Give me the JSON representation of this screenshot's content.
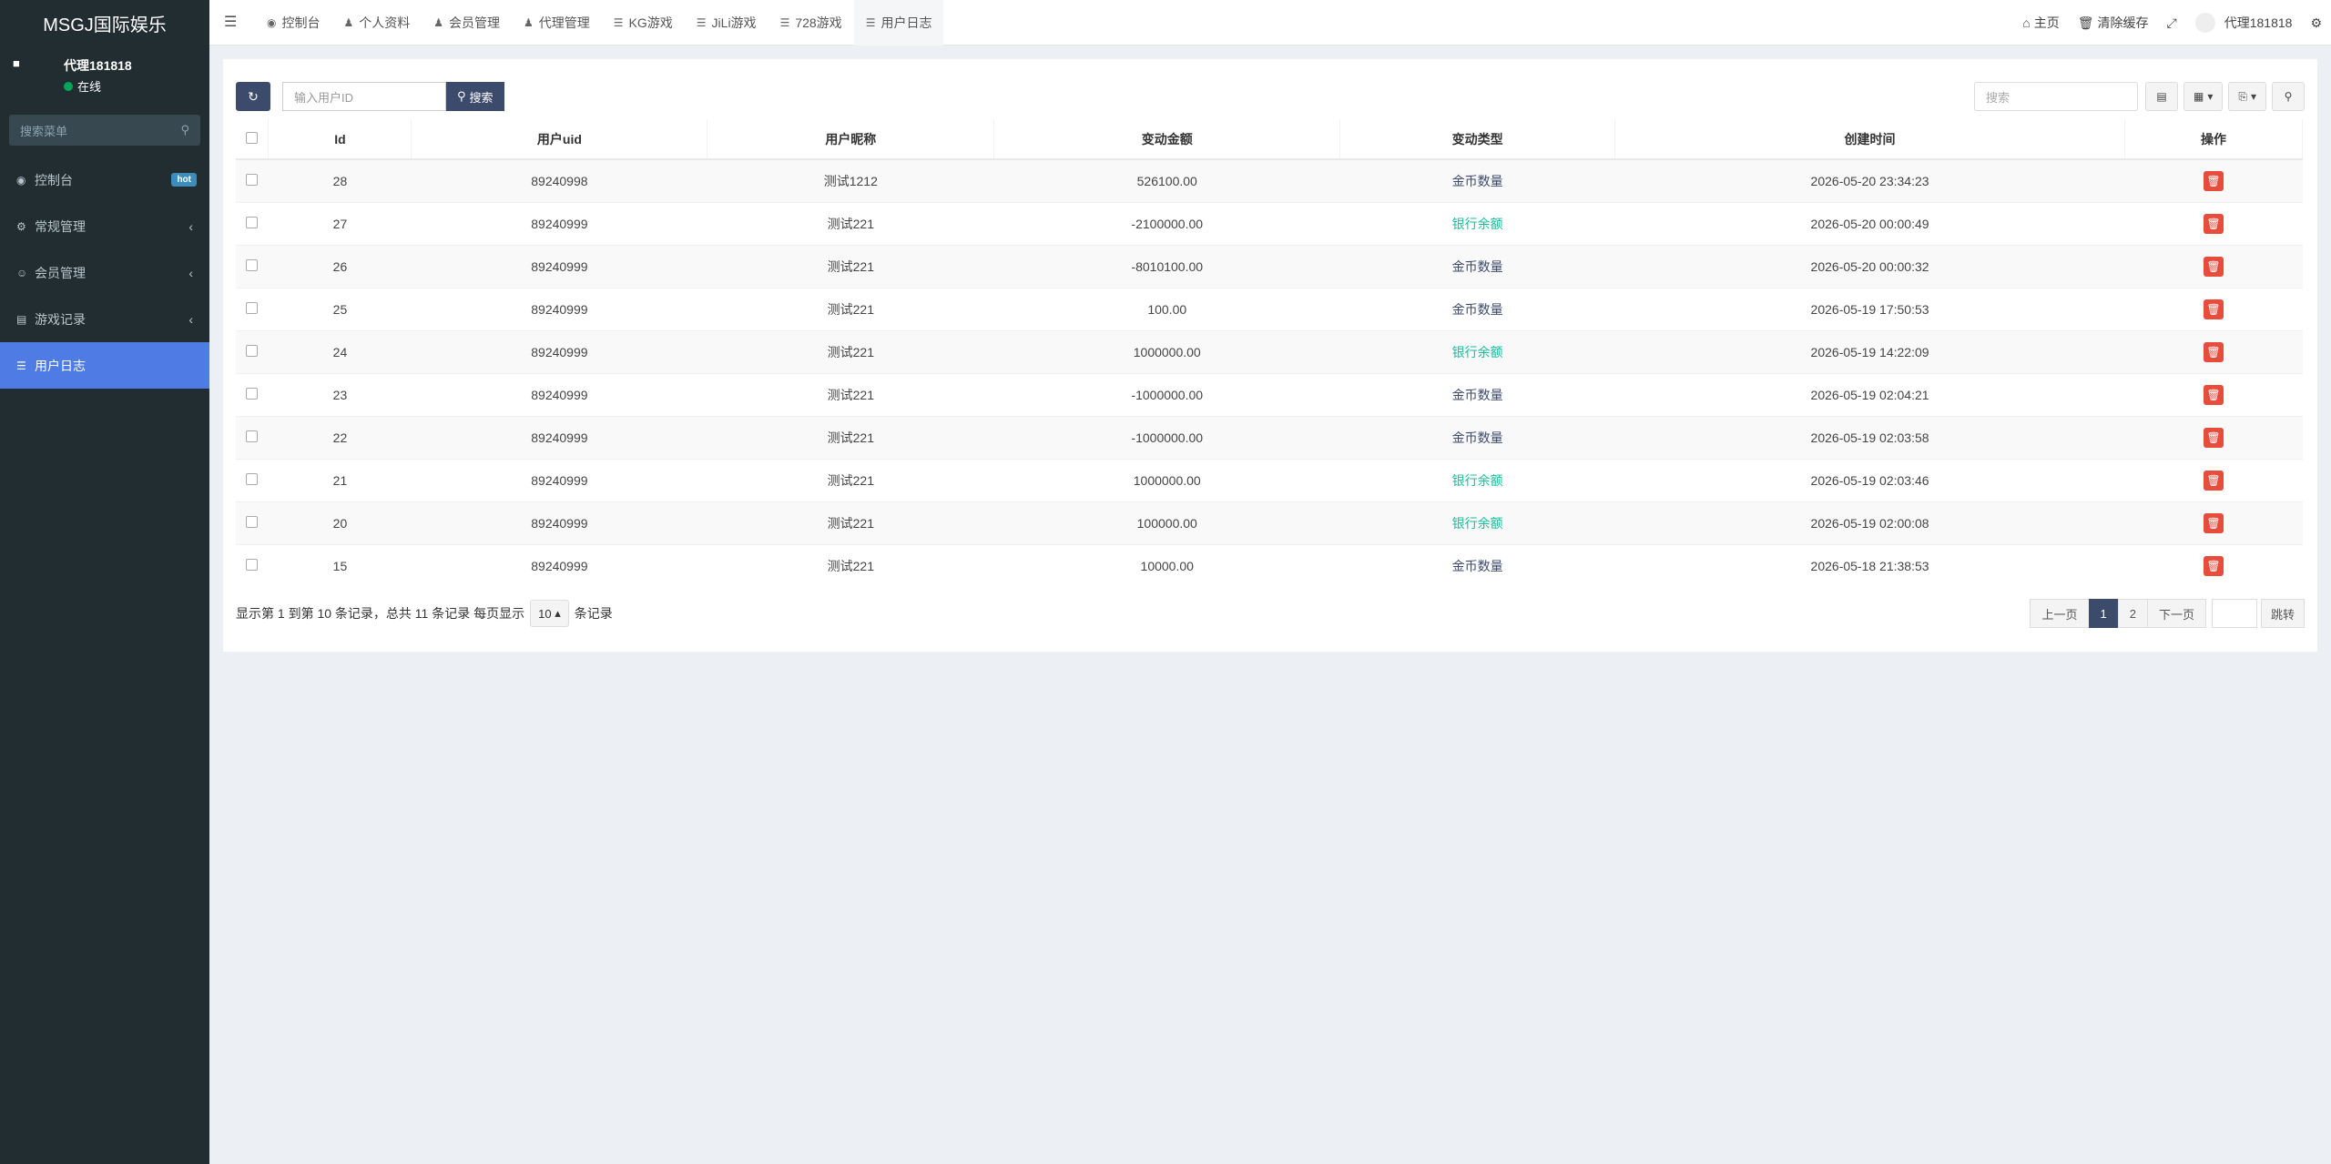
{
  "sidebar": {
    "logo": "MSGJ国际娱乐",
    "user_name": "代理181818",
    "user_status": "在线",
    "search_placeholder": "搜索菜单",
    "items": [
      {
        "label": "控制台",
        "badge": "hot",
        "icon": "dashboard-icon"
      },
      {
        "label": "常规管理",
        "icon": "cogs-icon"
      },
      {
        "label": "会员管理",
        "icon": "user-circle-icon"
      },
      {
        "label": "游戏记录",
        "icon": "gamepad-icon"
      },
      {
        "label": "用户日志",
        "icon": "database-icon"
      }
    ]
  },
  "topbar": {
    "tabs": [
      {
        "label": "控制台",
        "icon": "dashboard-icon"
      },
      {
        "label": "个人资料",
        "icon": "user-icon"
      },
      {
        "label": "会员管理",
        "icon": "user-icon"
      },
      {
        "label": "代理管理",
        "icon": "users-icon"
      },
      {
        "label": "KG游戏",
        "icon": "list-icon"
      },
      {
        "label": "JiLi游戏",
        "icon": "list-icon"
      },
      {
        "label": "728游戏",
        "icon": "list-icon"
      },
      {
        "label": "用户日志",
        "icon": "database-icon"
      }
    ],
    "home": "主页",
    "clear_cache": "清除缓存",
    "user": "代理181818"
  },
  "toolbar": {
    "uid_placeholder": "输入用户ID",
    "search_btn": "搜索",
    "search_placeholder": "搜索"
  },
  "table": {
    "headers": [
      "Id",
      "用户uid",
      "用户昵称",
      "变动金额",
      "变动类型",
      "创建时间",
      "操作"
    ],
    "rows": [
      {
        "id": "28",
        "uid": "89240998",
        "nick": "测试1212",
        "amount": "526100.00",
        "type": "金币数量",
        "time": "2026-05-20 23:34:23"
      },
      {
        "id": "27",
        "uid": "89240999",
        "nick": "测试221",
        "amount": "-2100000.00",
        "type": "银行余额",
        "time": "2026-05-20 00:00:49"
      },
      {
        "id": "26",
        "uid": "89240999",
        "nick": "测试221",
        "amount": "-8010100.00",
        "type": "金币数量",
        "time": "2026-05-20 00:00:32"
      },
      {
        "id": "25",
        "uid": "89240999",
        "nick": "测试221",
        "amount": "100.00",
        "type": "金币数量",
        "time": "2026-05-19 17:50:53"
      },
      {
        "id": "24",
        "uid": "89240999",
        "nick": "测试221",
        "amount": "1000000.00",
        "type": "银行余额",
        "time": "2026-05-19 14:22:09"
      },
      {
        "id": "23",
        "uid": "89240999",
        "nick": "测试221",
        "amount": "-1000000.00",
        "type": "金币数量",
        "time": "2026-05-19 02:04:21"
      },
      {
        "id": "22",
        "uid": "89240999",
        "nick": "测试221",
        "amount": "-1000000.00",
        "type": "金币数量",
        "time": "2026-05-19 02:03:58"
      },
      {
        "id": "21",
        "uid": "89240999",
        "nick": "测试221",
        "amount": "1000000.00",
        "type": "银行余额",
        "time": "2026-05-19 02:03:46"
      },
      {
        "id": "20",
        "uid": "89240999",
        "nick": "测试221",
        "amount": "100000.00",
        "type": "银行余额",
        "time": "2026-05-19 02:00:08"
      },
      {
        "id": "15",
        "uid": "89240999",
        "nick": "测试221",
        "amount": "10000.00",
        "type": "金币数量",
        "time": "2026-05-18 21:38:53"
      }
    ]
  },
  "pagination": {
    "info_prefix": "显示第 1 到第 10 条记录，总共 11 条记录 每页显示",
    "page_size": "10",
    "info_suffix": "条记录",
    "prev": "上一页",
    "pages": [
      "1",
      "2"
    ],
    "next": "下一页",
    "go": "跳转"
  },
  "colors": {
    "sidebar_bg": "#222d32",
    "active_menu": "#4f7be4",
    "primary_btn": "#3c4a6b",
    "bank_type": "#18bc9c",
    "delete_btn": "#e74c3c"
  }
}
